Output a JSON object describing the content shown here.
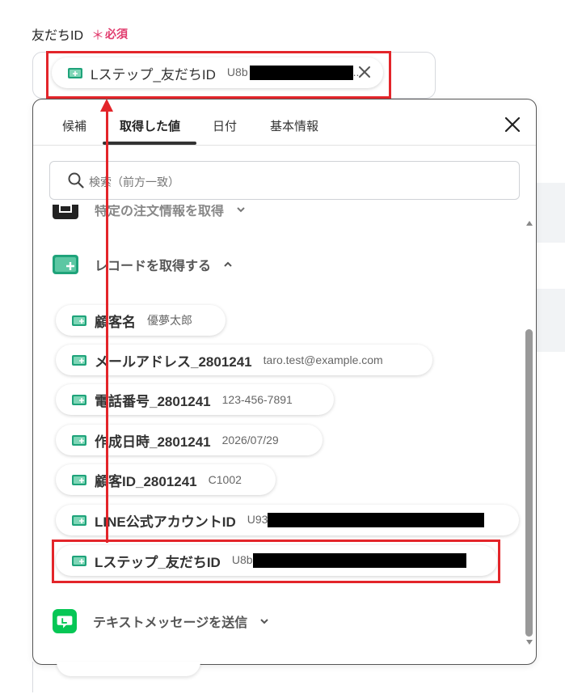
{
  "field": {
    "label": "友だちID",
    "required_mark": "＊",
    "required_text": "必須",
    "selected": {
      "label": "Lステップ_友だちID",
      "value_prefix": "U8b",
      "ellipsis": "..."
    }
  },
  "tabs": [
    {
      "label": "候補"
    },
    {
      "label": "取得した値"
    },
    {
      "label": "日付"
    },
    {
      "label": "基本情報"
    }
  ],
  "search": {
    "placeholder": "検索（前方一致）"
  },
  "groups": {
    "partial": {
      "title": "特定の注文情報を取得"
    },
    "records": {
      "title": "レコードを取得する"
    },
    "line": {
      "title": "テキストメッセージを送信"
    }
  },
  "items": [
    {
      "label": "顧客名",
      "value": "優夢太郎"
    },
    {
      "label": "メールアドレス_2801241",
      "value": "taro.test@example.com"
    },
    {
      "label": "電話番号_2801241",
      "value": "123-456-7891"
    },
    {
      "label": "作成日時_2801241",
      "value": "2026/07/29"
    },
    {
      "label": "顧客ID_2801241",
      "value": "C1002"
    },
    {
      "label": "LINE公式アカウントID",
      "value": "U93"
    },
    {
      "label": "Lステップ_友だちID",
      "value": "U8b"
    }
  ],
  "colors": {
    "accent_red": "#e3252a",
    "required_pink": "#e13b6d",
    "sheet_icon_green": "#1fa37a",
    "line_green": "#06c755"
  },
  "active_tab": "取得した値"
}
